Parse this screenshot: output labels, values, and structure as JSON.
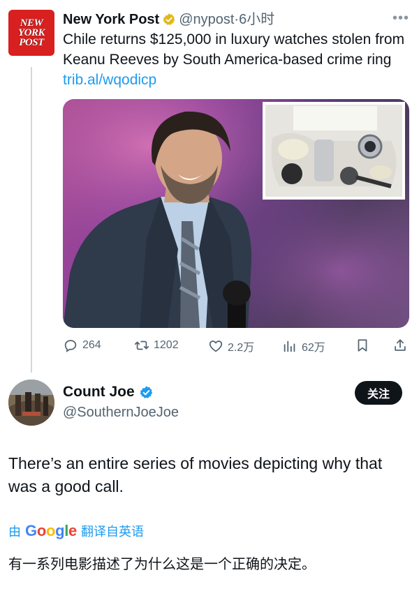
{
  "colors": {
    "link": "#1d9bf0",
    "nypost_red": "#d7201f",
    "verified_gold": "#e2b719",
    "verified_blue": "#1d9bf0",
    "text_secondary": "#536471",
    "follow_button_bg": "#0f1419"
  },
  "parent_tweet": {
    "avatar_text_lines": [
      "NEW",
      "YORK",
      "POST"
    ],
    "display_name": "New York Post",
    "verified_badge_icon": "gold-verified-icon",
    "handle_and_time": "@nypost·6小时",
    "more_icon": "more-dots-icon",
    "text_main": "Chile returns $125,000 in luxury watches stolen from Keanu Reeves by South America-based crime ring ",
    "link": "trib.al/wqodicp",
    "actions": {
      "replies": {
        "icon": "reply-icon",
        "count": "264"
      },
      "retweets": {
        "icon": "retweet-icon",
        "count": "1202"
      },
      "likes": {
        "icon": "heart-icon",
        "count": "2.2万"
      },
      "views": {
        "icon": "views-icon",
        "count": "62万"
      },
      "bookmark": {
        "icon": "bookmark-icon"
      },
      "share": {
        "icon": "share-icon"
      }
    }
  },
  "reply_tweet": {
    "display_name": "Count Joe",
    "verified_badge_icon": "blue-verified-icon",
    "handle": "@SouthernJoeJoe",
    "follow_label": "关注",
    "text": "There’s an entire series of movies depicting why that was a good call.",
    "translate": {
      "prefix": "由",
      "google_letters": [
        "G",
        "o",
        "o",
        "g",
        "l",
        "e"
      ],
      "suffix": "翻译自英语"
    },
    "translated_text": "有一系列电影描述了为什么这是一个正确的决定。"
  }
}
